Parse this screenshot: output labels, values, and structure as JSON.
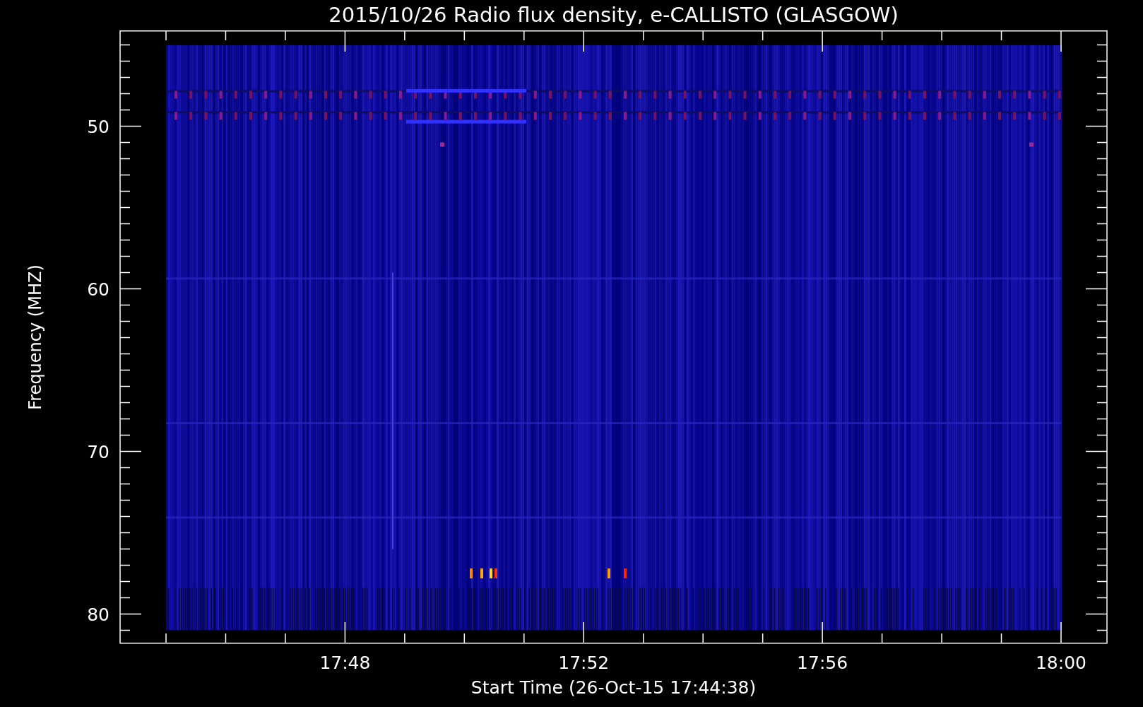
{
  "title": "2015/10/26  Radio flux density, e-CALLISTO (GLASGOW)",
  "y_axis": {
    "label": "Frequency (MHZ)",
    "ticks": [
      "50",
      "60",
      "70",
      "80"
    ]
  },
  "x_axis": {
    "label": "Start Time (26-Oct-15 17:44:38)",
    "ticks": [
      "17:48",
      "17:52",
      "17:56",
      "18:00"
    ]
  }
}
